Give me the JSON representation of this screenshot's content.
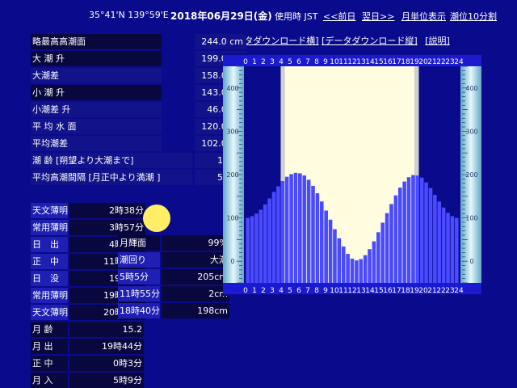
{
  "header": {
    "coords": "35°41'N 139°59'E",
    "date": "2018年06月29日(金)",
    "timezone": "使用時 JST",
    "prev_day": "<<前日",
    "next_day": "翌日>>",
    "monthly": "月単位表示",
    "ten_min": "潮位10分割"
  },
  "links": {
    "download_h": "[データダウンロード横]",
    "download_v": "[データダウンロード縦]",
    "help": "[説明]"
  },
  "levels": [
    {
      "label": "略最高高潮面",
      "value": "244.0 cm"
    },
    {
      "label": "大 潮 升",
      "value": "199.0 cm"
    },
    {
      "label": "大潮差",
      "value": "158.0 cm"
    },
    {
      "label": "小 潮 升",
      "value": "143.0 cm"
    },
    {
      "label": "小潮差 升",
      "value": "46.0 cm"
    },
    {
      "label": "平 均 水 面",
      "value": "120.0 cm"
    },
    {
      "label": "平均潮差",
      "value": "102.0 cm"
    },
    {
      "label": "潮 齢 [朔望より大潮まで]",
      "value": "1.2 日"
    },
    {
      "label": "平均高潮間隔 [月正中より満潮 ]",
      "value": "5.6 時"
    }
  ],
  "sun": [
    {
      "label": "天文薄明",
      "value": "2時38分"
    },
    {
      "label": "常用薄明",
      "value": "3時57分"
    },
    {
      "label": "日　出",
      "value": "4時26分"
    },
    {
      "label": "正　中",
      "value": "11時43分"
    },
    {
      "label": "日　没",
      "value": "19時0分"
    },
    {
      "label": "常用薄明",
      "value": "19時30分"
    },
    {
      "label": "天文薄明",
      "value": "20時48分"
    }
  ],
  "moon": [
    {
      "label": "月 齢",
      "value": "15.2"
    },
    {
      "label": "月 出",
      "value": "19時44分"
    },
    {
      "label": "正 中",
      "value": "0時3分"
    },
    {
      "label": "月 入",
      "value": "5時9分"
    }
  ],
  "moon_info": [
    {
      "label": "月輝面",
      "value": "99%"
    },
    {
      "label": "潮回り",
      "value": "大潮"
    },
    {
      "label": "5時5分",
      "value": "205cm"
    },
    {
      "label": "11時55分",
      "value": "2cm"
    },
    {
      "label": "18時40分",
      "value": "198cm"
    }
  ],
  "colors": {
    "background": "#0a0a8c",
    "moon": "#ffee66",
    "bars": "#4a4aff",
    "daylight": "#fffce0",
    "twilight": "#cfcfcf"
  },
  "chart_data": {
    "type": "bar",
    "x_ticks": [
      "0",
      "1",
      "2",
      "3",
      "4",
      "5",
      "6",
      "7",
      "8",
      "9",
      "10",
      "11",
      "12",
      "13",
      "14",
      "15",
      "16",
      "17",
      "18",
      "19",
      "20",
      "21",
      "22",
      "23",
      "24"
    ],
    "y_ticks": [
      "400",
      "300",
      "200",
      "100",
      "0"
    ],
    "ylim": [
      -50,
      450
    ],
    "xlim": [
      0,
      24
    ],
    "x": [
      0,
      0.5,
      1,
      1.5,
      2,
      2.5,
      3,
      3.5,
      4,
      4.5,
      5,
      5.5,
      6,
      6.5,
      7,
      7.5,
      8,
      8.5,
      9,
      9.5,
      10,
      10.5,
      11,
      11.5,
      12,
      12.5,
      13,
      13.5,
      14,
      14.5,
      15,
      15.5,
      16,
      16.5,
      17,
      17.5,
      18,
      18.5,
      19,
      19.5,
      20,
      20.5,
      21,
      21.5,
      22,
      22.5,
      23,
      23.5,
      24
    ],
    "values": [
      100,
      104,
      110,
      119,
      131,
      145,
      160,
      173,
      185,
      195,
      201,
      204,
      203,
      198,
      188,
      174,
      157,
      138,
      117,
      96,
      74,
      53,
      34,
      17,
      6,
      2,
      5,
      14,
      28,
      46,
      67,
      89,
      111,
      132,
      152,
      170,
      184,
      194,
      199,
      198,
      193,
      182,
      169,
      153,
      138,
      124,
      112,
      104,
      100
    ],
    "daylight_hours": [
      4.43,
      19.0
    ],
    "twilight_hours": [
      3.95,
      19.5
    ]
  }
}
